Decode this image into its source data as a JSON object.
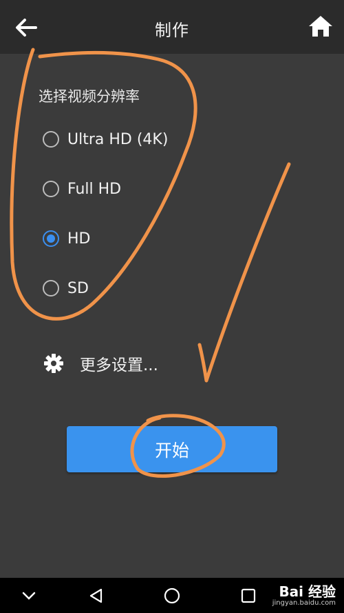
{
  "header": {
    "title": "制作",
    "back_icon": "back-arrow-icon",
    "home_icon": "home-icon"
  },
  "resolution": {
    "label": "选择视频分辨率",
    "options": [
      {
        "label": "Ultra HD (4K)",
        "checked": false
      },
      {
        "label": "Full HD",
        "checked": false
      },
      {
        "label": "HD",
        "checked": true
      },
      {
        "label": "SD",
        "checked": false
      }
    ],
    "selected": "HD"
  },
  "more_settings": {
    "label": "更多设置...",
    "icon": "gear-icon"
  },
  "start_button": {
    "label": "开始"
  },
  "nav": {
    "icons": [
      "collapse-icon",
      "back-triangle-icon",
      "home-circle-icon",
      "recents-square-icon"
    ]
  },
  "watermark": {
    "main": "Bai 经验",
    "sub": "jingyan.baidu.com"
  },
  "colors": {
    "background": "#3b3b3b",
    "topbar": "#2b2b2b",
    "accent": "#3a93ee",
    "annotation": "#f0934a"
  }
}
